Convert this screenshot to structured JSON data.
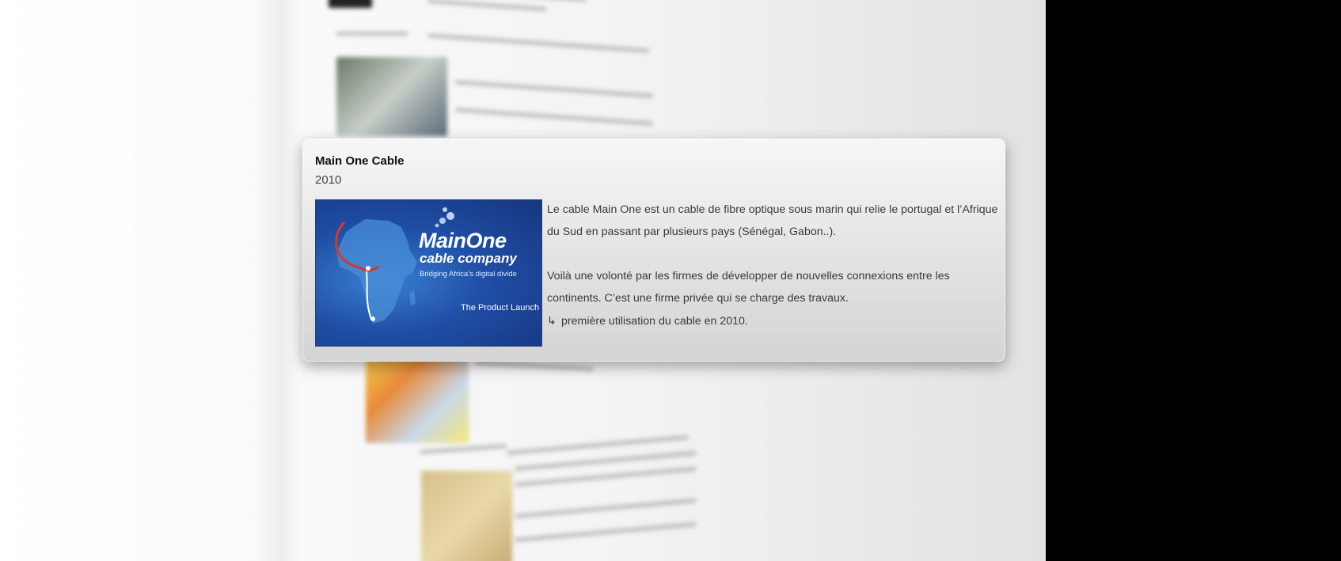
{
  "card": {
    "title": "Main One Cable",
    "year": "2010",
    "image": {
      "brand_name": "MainOne",
      "brand_subtitle": "cable company",
      "tagline": "Bridging Africa’s digital divide",
      "launch_label": "The Product Launch"
    },
    "paragraphs": [
      "Le cable Main One est un cable de fibre optique sous marin qui relie le portugal et l’Afrique du Sud en passant par plusieurs pays (Sénégal, Gabon..).",
      "Voilà une volonté par les firmes de développer de nouvelles connexions entre les continents. C’est une firme privée qui se charge des travaux."
    ],
    "note_icon": "return-arrow-icon",
    "note": "première utilisation du cable en 2010."
  },
  "colors": {
    "popup_bg": "#e6e6e6",
    "image_bg": "#1f4fa6",
    "right_panel": "#000000"
  }
}
